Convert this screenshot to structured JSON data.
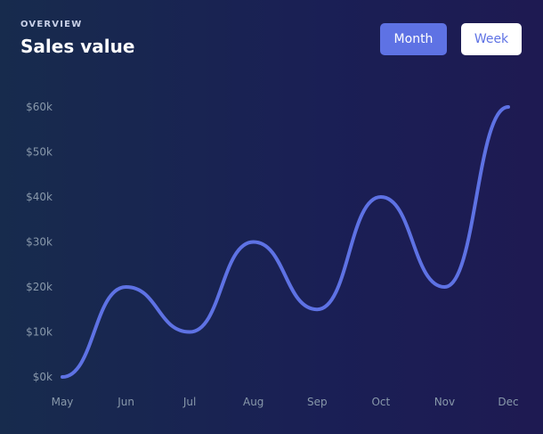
{
  "header": {
    "eyebrow": "OVERVIEW",
    "title": "Sales value"
  },
  "toggle": {
    "month_label": "Month",
    "week_label": "Week",
    "active": "Month"
  },
  "colors": {
    "line": "#5e72e4",
    "tick_text": "#8898aa",
    "active_button": "#5e72e4",
    "inactive_button": "#ffffff"
  },
  "chart_data": {
    "type": "line",
    "categories": [
      "May",
      "Jun",
      "Jul",
      "Aug",
      "Sep",
      "Oct",
      "Nov",
      "Dec"
    ],
    "series": [
      {
        "values": [
          0,
          20,
          10,
          30,
          15,
          40,
          20,
          60
        ]
      }
    ],
    "yticks": [
      "$0k",
      "$10k",
      "$20k",
      "$30k",
      "$40k",
      "$50k",
      "$60k"
    ],
    "ylim": [
      0,
      60
    ],
    "grid": false,
    "title": "",
    "xlabel": "",
    "ylabel": ""
  }
}
